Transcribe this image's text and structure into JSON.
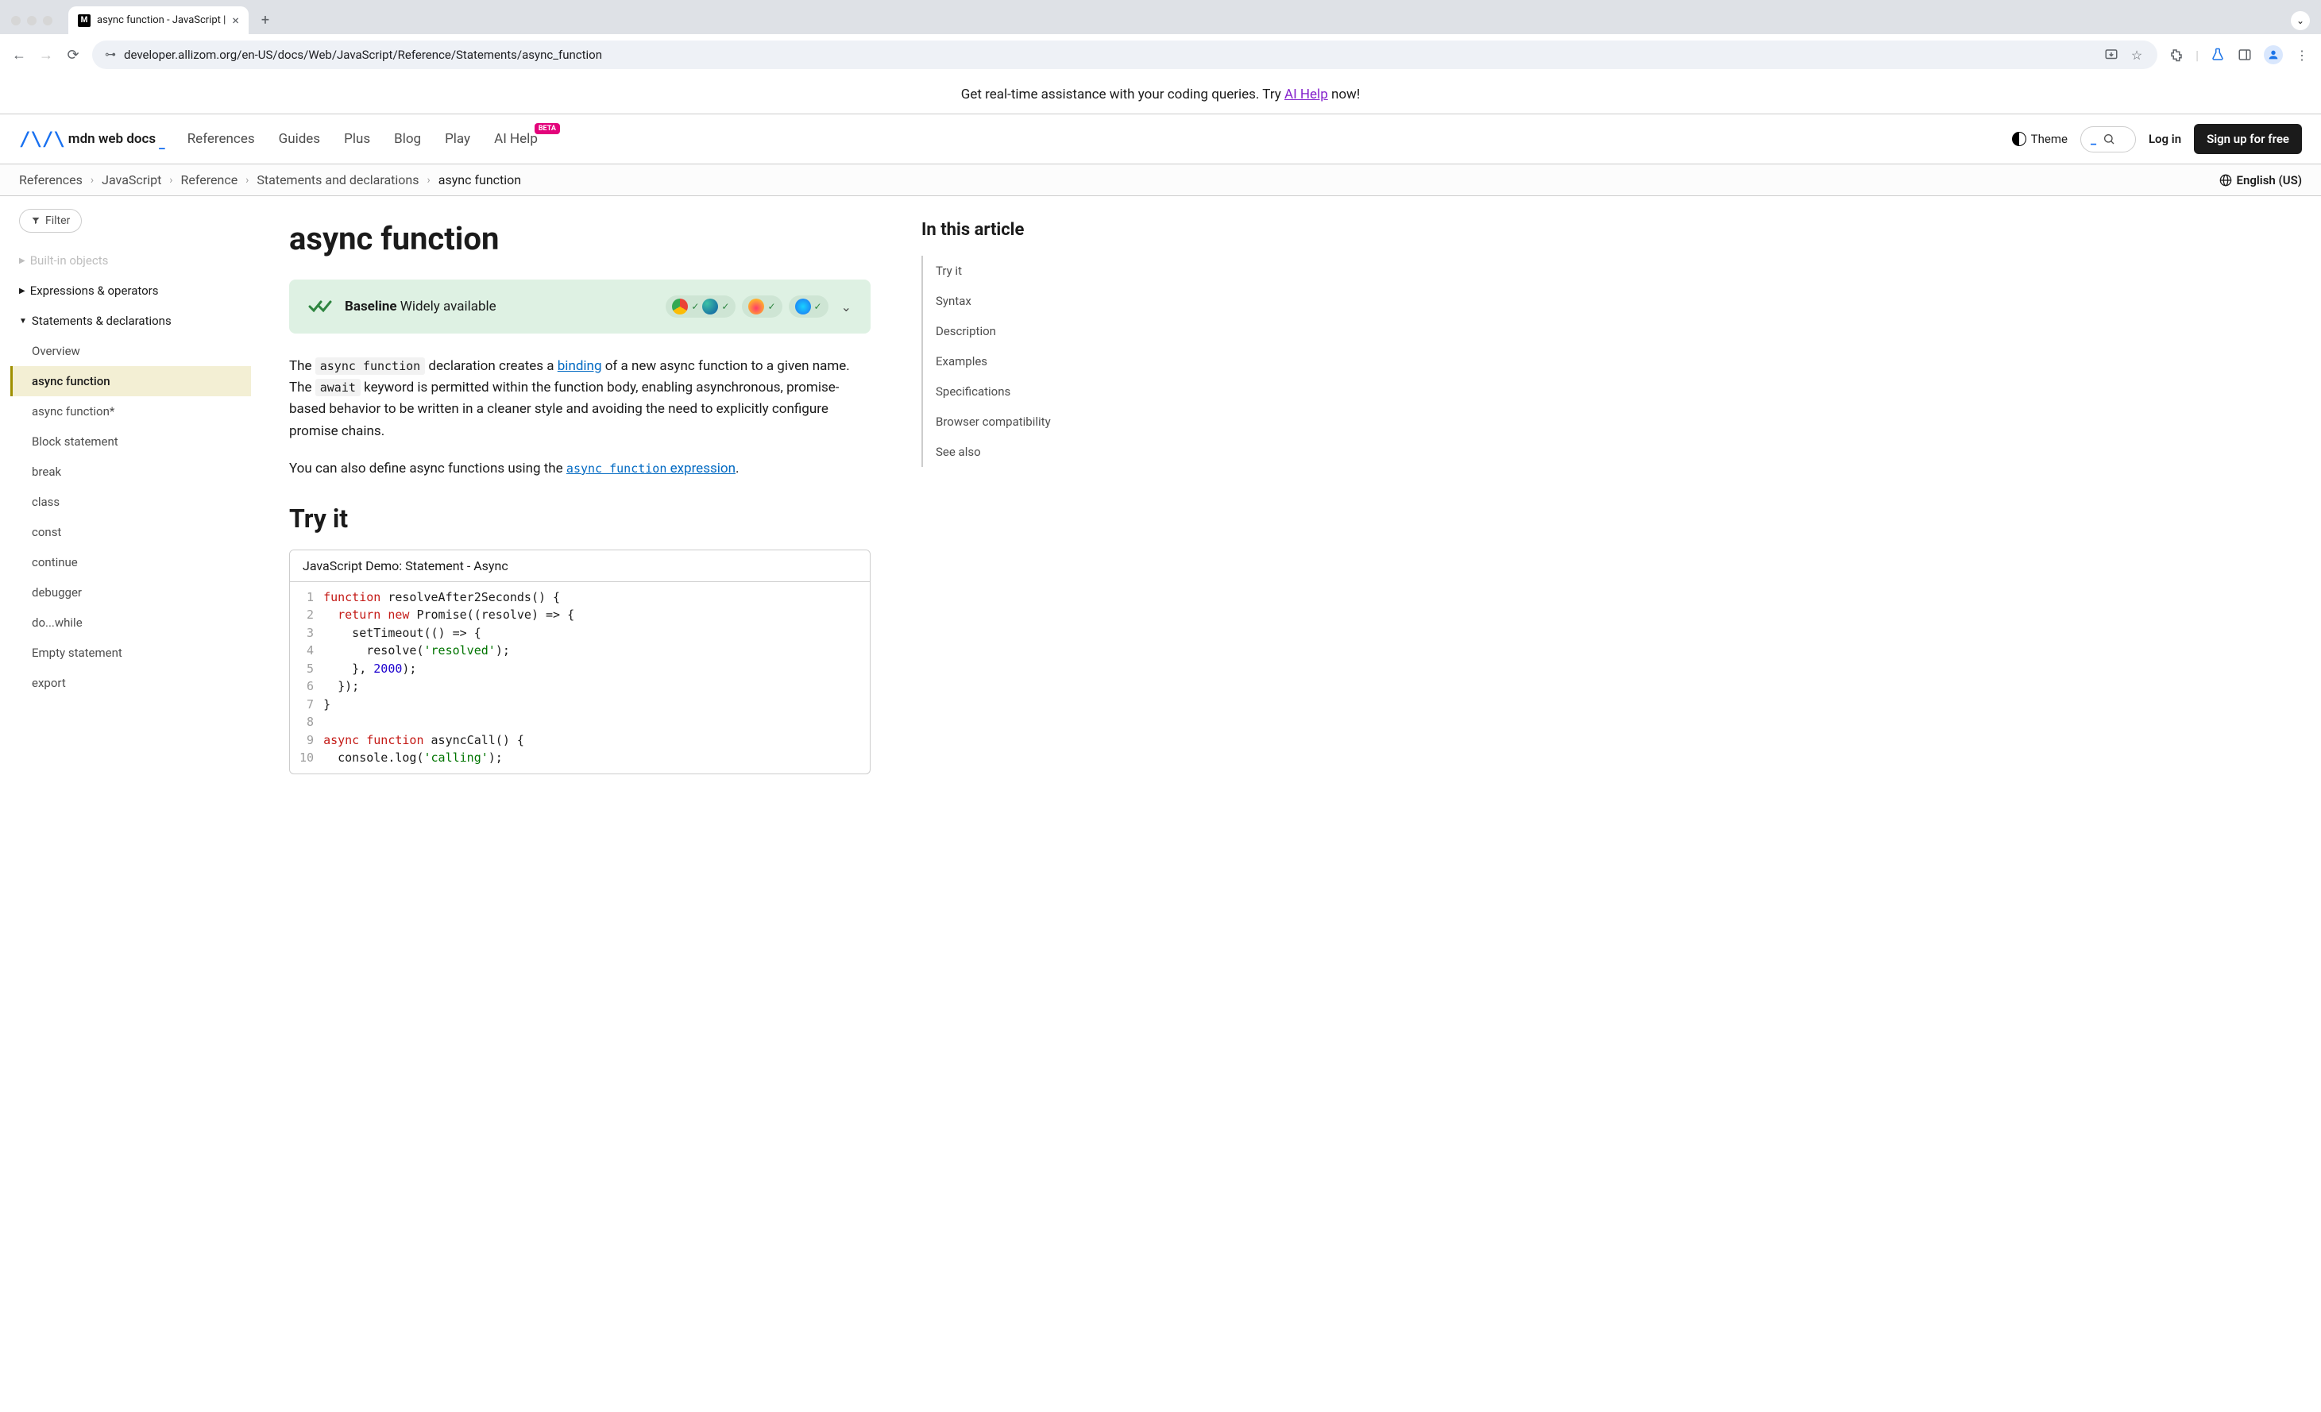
{
  "browser": {
    "tab_title": "async function - JavaScript |",
    "url": "developer.allizom.org/en-US/docs/Web/JavaScript/Reference/Statements/async_function"
  },
  "banner": {
    "text_before": "Get real-time assistance with your coding queries. Try ",
    "link": "AI Help",
    "text_after": " now!"
  },
  "header": {
    "logo_text": "mdn web docs",
    "nav": [
      "References",
      "Guides",
      "Plus",
      "Blog",
      "Play",
      "AI Help"
    ],
    "beta_label": "BETA",
    "theme_label": "Theme",
    "login_label": "Log in",
    "signup_label": "Sign up for free"
  },
  "breadcrumbs": {
    "items": [
      "References",
      "JavaScript",
      "Reference",
      "Statements and declarations",
      "async function"
    ],
    "language": "English (US)"
  },
  "sidebar": {
    "filter_label": "Filter",
    "faded_group": "Built-in objects",
    "groups": [
      {
        "title": "Expressions & operators",
        "expanded": false
      },
      {
        "title": "Statements & declarations",
        "expanded": true
      }
    ],
    "items": [
      "Overview",
      "async function",
      "async function*",
      "Block statement",
      "break",
      "class",
      "const",
      "continue",
      "debugger",
      "do...while",
      "Empty statement",
      "export"
    ],
    "active_index": 1
  },
  "article": {
    "title": "async function",
    "baseline_strong": "Baseline",
    "baseline_rest": " Widely available",
    "p1_before_code1": "The ",
    "p1_code1": "async function",
    "p1_mid1": " declaration creates a ",
    "p1_link1": "binding",
    "p1_mid2": " of a new async function to a given name. The ",
    "p1_code2": "await",
    "p1_after": " keyword is permitted within the function body, enabling asynchronous, promise-based behavior to be written in a cleaner style and avoiding the need to explicitly configure promise chains.",
    "p2_before": "You can also define async functions using the ",
    "p2_link_code": "async function",
    "p2_link_rest": " expression",
    "p2_after": ".",
    "tryit_heading": "Try it",
    "demo_header": "JavaScript Demo: Statement - Async",
    "code_lines": [
      "function resolveAfter2Seconds() {",
      "  return new Promise((resolve) => {",
      "    setTimeout(() => {",
      "      resolve('resolved');",
      "    }, 2000);",
      "  });",
      "}",
      "",
      "async function asyncCall() {",
      "  console.log('calling');"
    ]
  },
  "toc": {
    "heading": "In this article",
    "items": [
      "Try it",
      "Syntax",
      "Description",
      "Examples",
      "Specifications",
      "Browser compatibility",
      "See also"
    ]
  }
}
